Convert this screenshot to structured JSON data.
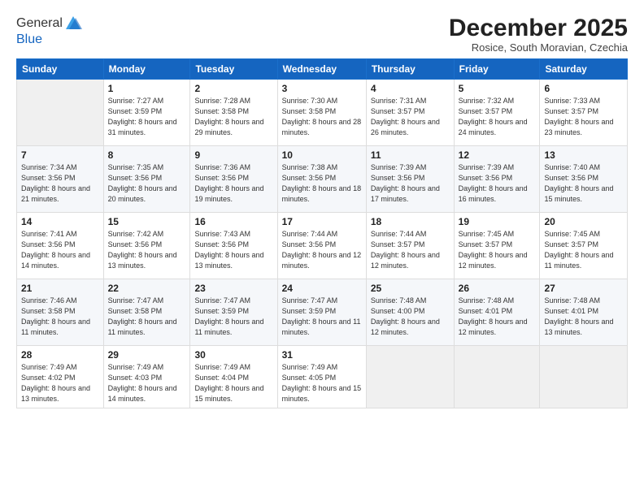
{
  "header": {
    "logo_line1": "General",
    "logo_line2": "Blue",
    "month_title": "December 2025",
    "subtitle": "Rosice, South Moravian, Czechia"
  },
  "days_of_week": [
    "Sunday",
    "Monday",
    "Tuesday",
    "Wednesday",
    "Thursday",
    "Friday",
    "Saturday"
  ],
  "weeks": [
    [
      {
        "day": "",
        "info": ""
      },
      {
        "day": "1",
        "info": "Sunrise: 7:27 AM\nSunset: 3:59 PM\nDaylight: 8 hours\nand 31 minutes."
      },
      {
        "day": "2",
        "info": "Sunrise: 7:28 AM\nSunset: 3:58 PM\nDaylight: 8 hours\nand 29 minutes."
      },
      {
        "day": "3",
        "info": "Sunrise: 7:30 AM\nSunset: 3:58 PM\nDaylight: 8 hours\nand 28 minutes."
      },
      {
        "day": "4",
        "info": "Sunrise: 7:31 AM\nSunset: 3:57 PM\nDaylight: 8 hours\nand 26 minutes."
      },
      {
        "day": "5",
        "info": "Sunrise: 7:32 AM\nSunset: 3:57 PM\nDaylight: 8 hours\nand 24 minutes."
      },
      {
        "day": "6",
        "info": "Sunrise: 7:33 AM\nSunset: 3:57 PM\nDaylight: 8 hours\nand 23 minutes."
      }
    ],
    [
      {
        "day": "7",
        "info": "Sunrise: 7:34 AM\nSunset: 3:56 PM\nDaylight: 8 hours\nand 21 minutes."
      },
      {
        "day": "8",
        "info": "Sunrise: 7:35 AM\nSunset: 3:56 PM\nDaylight: 8 hours\nand 20 minutes."
      },
      {
        "day": "9",
        "info": "Sunrise: 7:36 AM\nSunset: 3:56 PM\nDaylight: 8 hours\nand 19 minutes."
      },
      {
        "day": "10",
        "info": "Sunrise: 7:38 AM\nSunset: 3:56 PM\nDaylight: 8 hours\nand 18 minutes."
      },
      {
        "day": "11",
        "info": "Sunrise: 7:39 AM\nSunset: 3:56 PM\nDaylight: 8 hours\nand 17 minutes."
      },
      {
        "day": "12",
        "info": "Sunrise: 7:39 AM\nSunset: 3:56 PM\nDaylight: 8 hours\nand 16 minutes."
      },
      {
        "day": "13",
        "info": "Sunrise: 7:40 AM\nSunset: 3:56 PM\nDaylight: 8 hours\nand 15 minutes."
      }
    ],
    [
      {
        "day": "14",
        "info": "Sunrise: 7:41 AM\nSunset: 3:56 PM\nDaylight: 8 hours\nand 14 minutes."
      },
      {
        "day": "15",
        "info": "Sunrise: 7:42 AM\nSunset: 3:56 PM\nDaylight: 8 hours\nand 13 minutes."
      },
      {
        "day": "16",
        "info": "Sunrise: 7:43 AM\nSunset: 3:56 PM\nDaylight: 8 hours\nand 13 minutes."
      },
      {
        "day": "17",
        "info": "Sunrise: 7:44 AM\nSunset: 3:56 PM\nDaylight: 8 hours\nand 12 minutes."
      },
      {
        "day": "18",
        "info": "Sunrise: 7:44 AM\nSunset: 3:57 PM\nDaylight: 8 hours\nand 12 minutes."
      },
      {
        "day": "19",
        "info": "Sunrise: 7:45 AM\nSunset: 3:57 PM\nDaylight: 8 hours\nand 12 minutes."
      },
      {
        "day": "20",
        "info": "Sunrise: 7:45 AM\nSunset: 3:57 PM\nDaylight: 8 hours\nand 11 minutes."
      }
    ],
    [
      {
        "day": "21",
        "info": "Sunrise: 7:46 AM\nSunset: 3:58 PM\nDaylight: 8 hours\nand 11 minutes."
      },
      {
        "day": "22",
        "info": "Sunrise: 7:47 AM\nSunset: 3:58 PM\nDaylight: 8 hours\nand 11 minutes."
      },
      {
        "day": "23",
        "info": "Sunrise: 7:47 AM\nSunset: 3:59 PM\nDaylight: 8 hours\nand 11 minutes."
      },
      {
        "day": "24",
        "info": "Sunrise: 7:47 AM\nSunset: 3:59 PM\nDaylight: 8 hours\nand 11 minutes."
      },
      {
        "day": "25",
        "info": "Sunrise: 7:48 AM\nSunset: 4:00 PM\nDaylight: 8 hours\nand 12 minutes."
      },
      {
        "day": "26",
        "info": "Sunrise: 7:48 AM\nSunset: 4:01 PM\nDaylight: 8 hours\nand 12 minutes."
      },
      {
        "day": "27",
        "info": "Sunrise: 7:48 AM\nSunset: 4:01 PM\nDaylight: 8 hours\nand 13 minutes."
      }
    ],
    [
      {
        "day": "28",
        "info": "Sunrise: 7:49 AM\nSunset: 4:02 PM\nDaylight: 8 hours\nand 13 minutes."
      },
      {
        "day": "29",
        "info": "Sunrise: 7:49 AM\nSunset: 4:03 PM\nDaylight: 8 hours\nand 14 minutes."
      },
      {
        "day": "30",
        "info": "Sunrise: 7:49 AM\nSunset: 4:04 PM\nDaylight: 8 hours\nand 15 minutes."
      },
      {
        "day": "31",
        "info": "Sunrise: 7:49 AM\nSunset: 4:05 PM\nDaylight: 8 hours\nand 15 minutes."
      },
      {
        "day": "",
        "info": ""
      },
      {
        "day": "",
        "info": ""
      },
      {
        "day": "",
        "info": ""
      }
    ]
  ]
}
